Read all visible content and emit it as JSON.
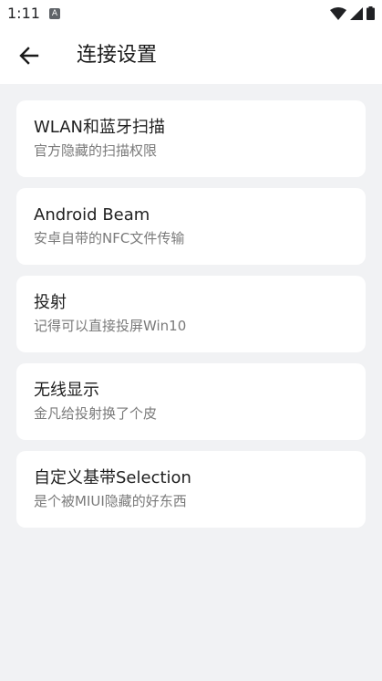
{
  "status_bar": {
    "time": "1:11",
    "notification_icon": "a-notification-icon",
    "icons": [
      "wifi-icon",
      "signal-icon",
      "battery-icon"
    ]
  },
  "app_bar": {
    "back_icon": "back-arrow-icon",
    "title": "连接设置"
  },
  "items": [
    {
      "title": "WLAN和蓝牙扫描",
      "subtitle": "官方隐藏的扫描权限"
    },
    {
      "title": "Android Beam",
      "subtitle": "安卓自带的NFC文件传输"
    },
    {
      "title": "投射",
      "subtitle": "记得可以直接投屏Win10"
    },
    {
      "title": "无线显示",
      "subtitle": "金凡给投射换了个皮"
    },
    {
      "title": "自定义基带Selection",
      "subtitle": "是个被MIUI隐藏的好东西"
    }
  ],
  "colors": {
    "background": "#f1f2f4",
    "card": "#ffffff",
    "title_text": "#1f1f1f",
    "subtitle_text": "#7a7a7a"
  }
}
